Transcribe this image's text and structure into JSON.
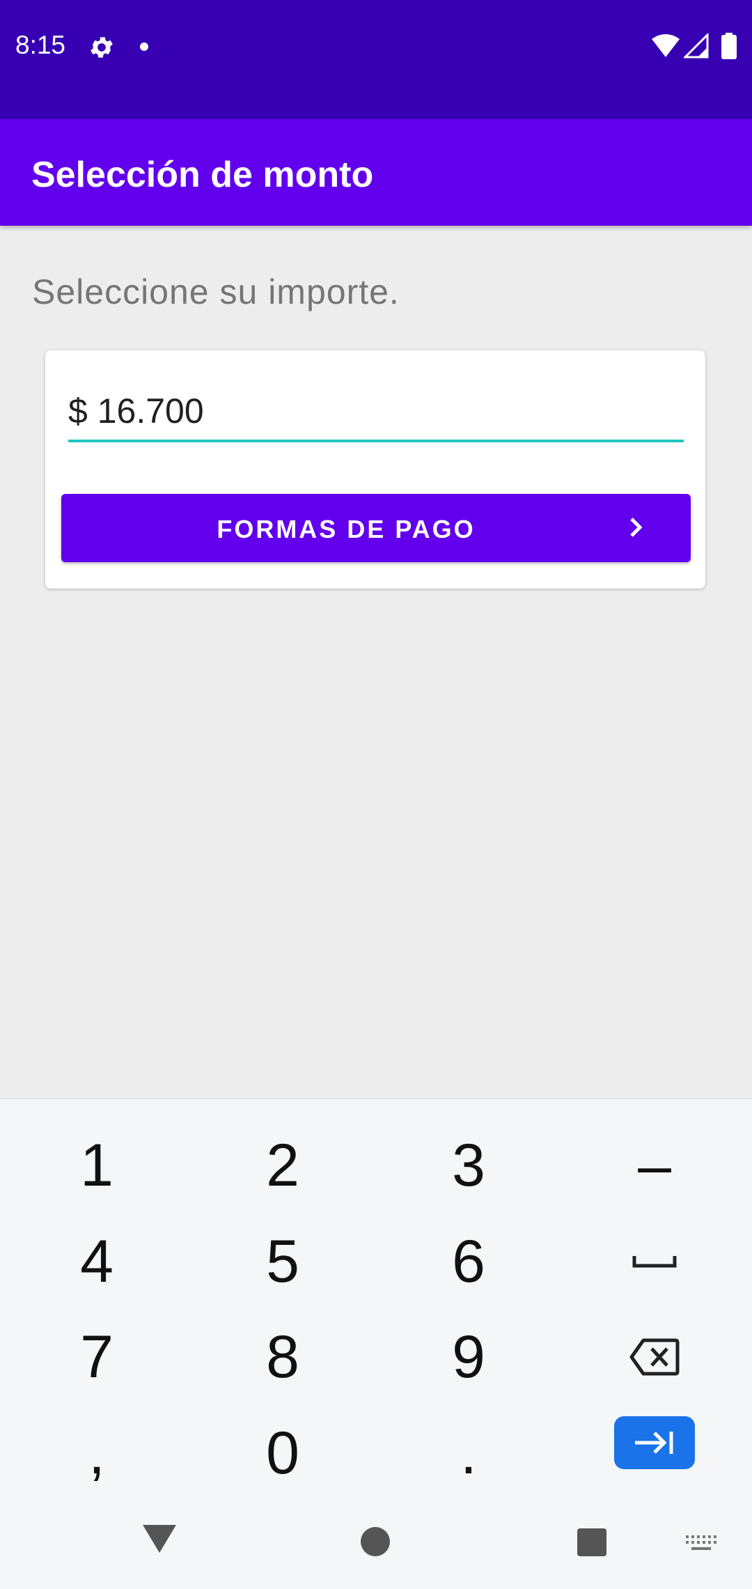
{
  "status_bar": {
    "time": "8:15"
  },
  "app_bar": {
    "title": "Selección de monto"
  },
  "main": {
    "prompt": "Seleccione su importe.",
    "amount": "$ 16.700",
    "pay_button_label": "FORMAS DE PAGO"
  },
  "keyboard": {
    "row1": [
      "1",
      "2",
      "3",
      "–"
    ],
    "row2": [
      "4",
      "5",
      "6"
    ],
    "row3": [
      "7",
      "8",
      "9"
    ],
    "row4": [
      ",",
      "0",
      "."
    ]
  },
  "colors": {
    "status_bar": "#3700b3",
    "primary": "#6200ee",
    "accent": "#1ec8c0",
    "enter_key": "#1a73e8"
  }
}
